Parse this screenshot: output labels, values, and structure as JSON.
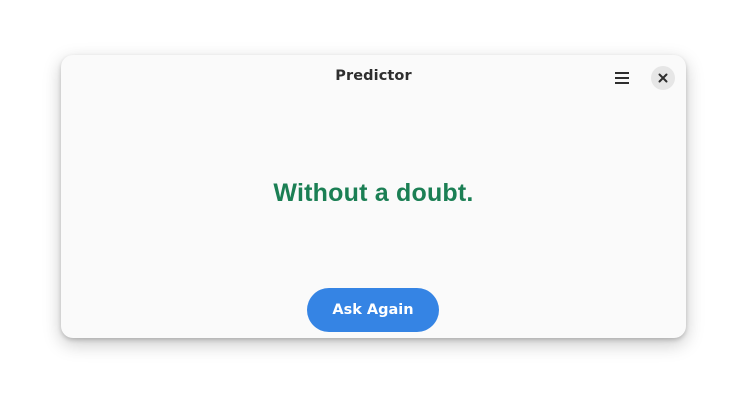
{
  "window": {
    "title": "Predictor"
  },
  "header": {
    "menu_icon": "hamburger-menu-icon",
    "close_icon": "close-icon"
  },
  "main": {
    "answer": "Without a doubt.",
    "ask_again_label": "Ask Again"
  },
  "colors": {
    "answer_text": "#1b7f54",
    "accent": "#3584e4",
    "window_bg": "#fafafa"
  }
}
